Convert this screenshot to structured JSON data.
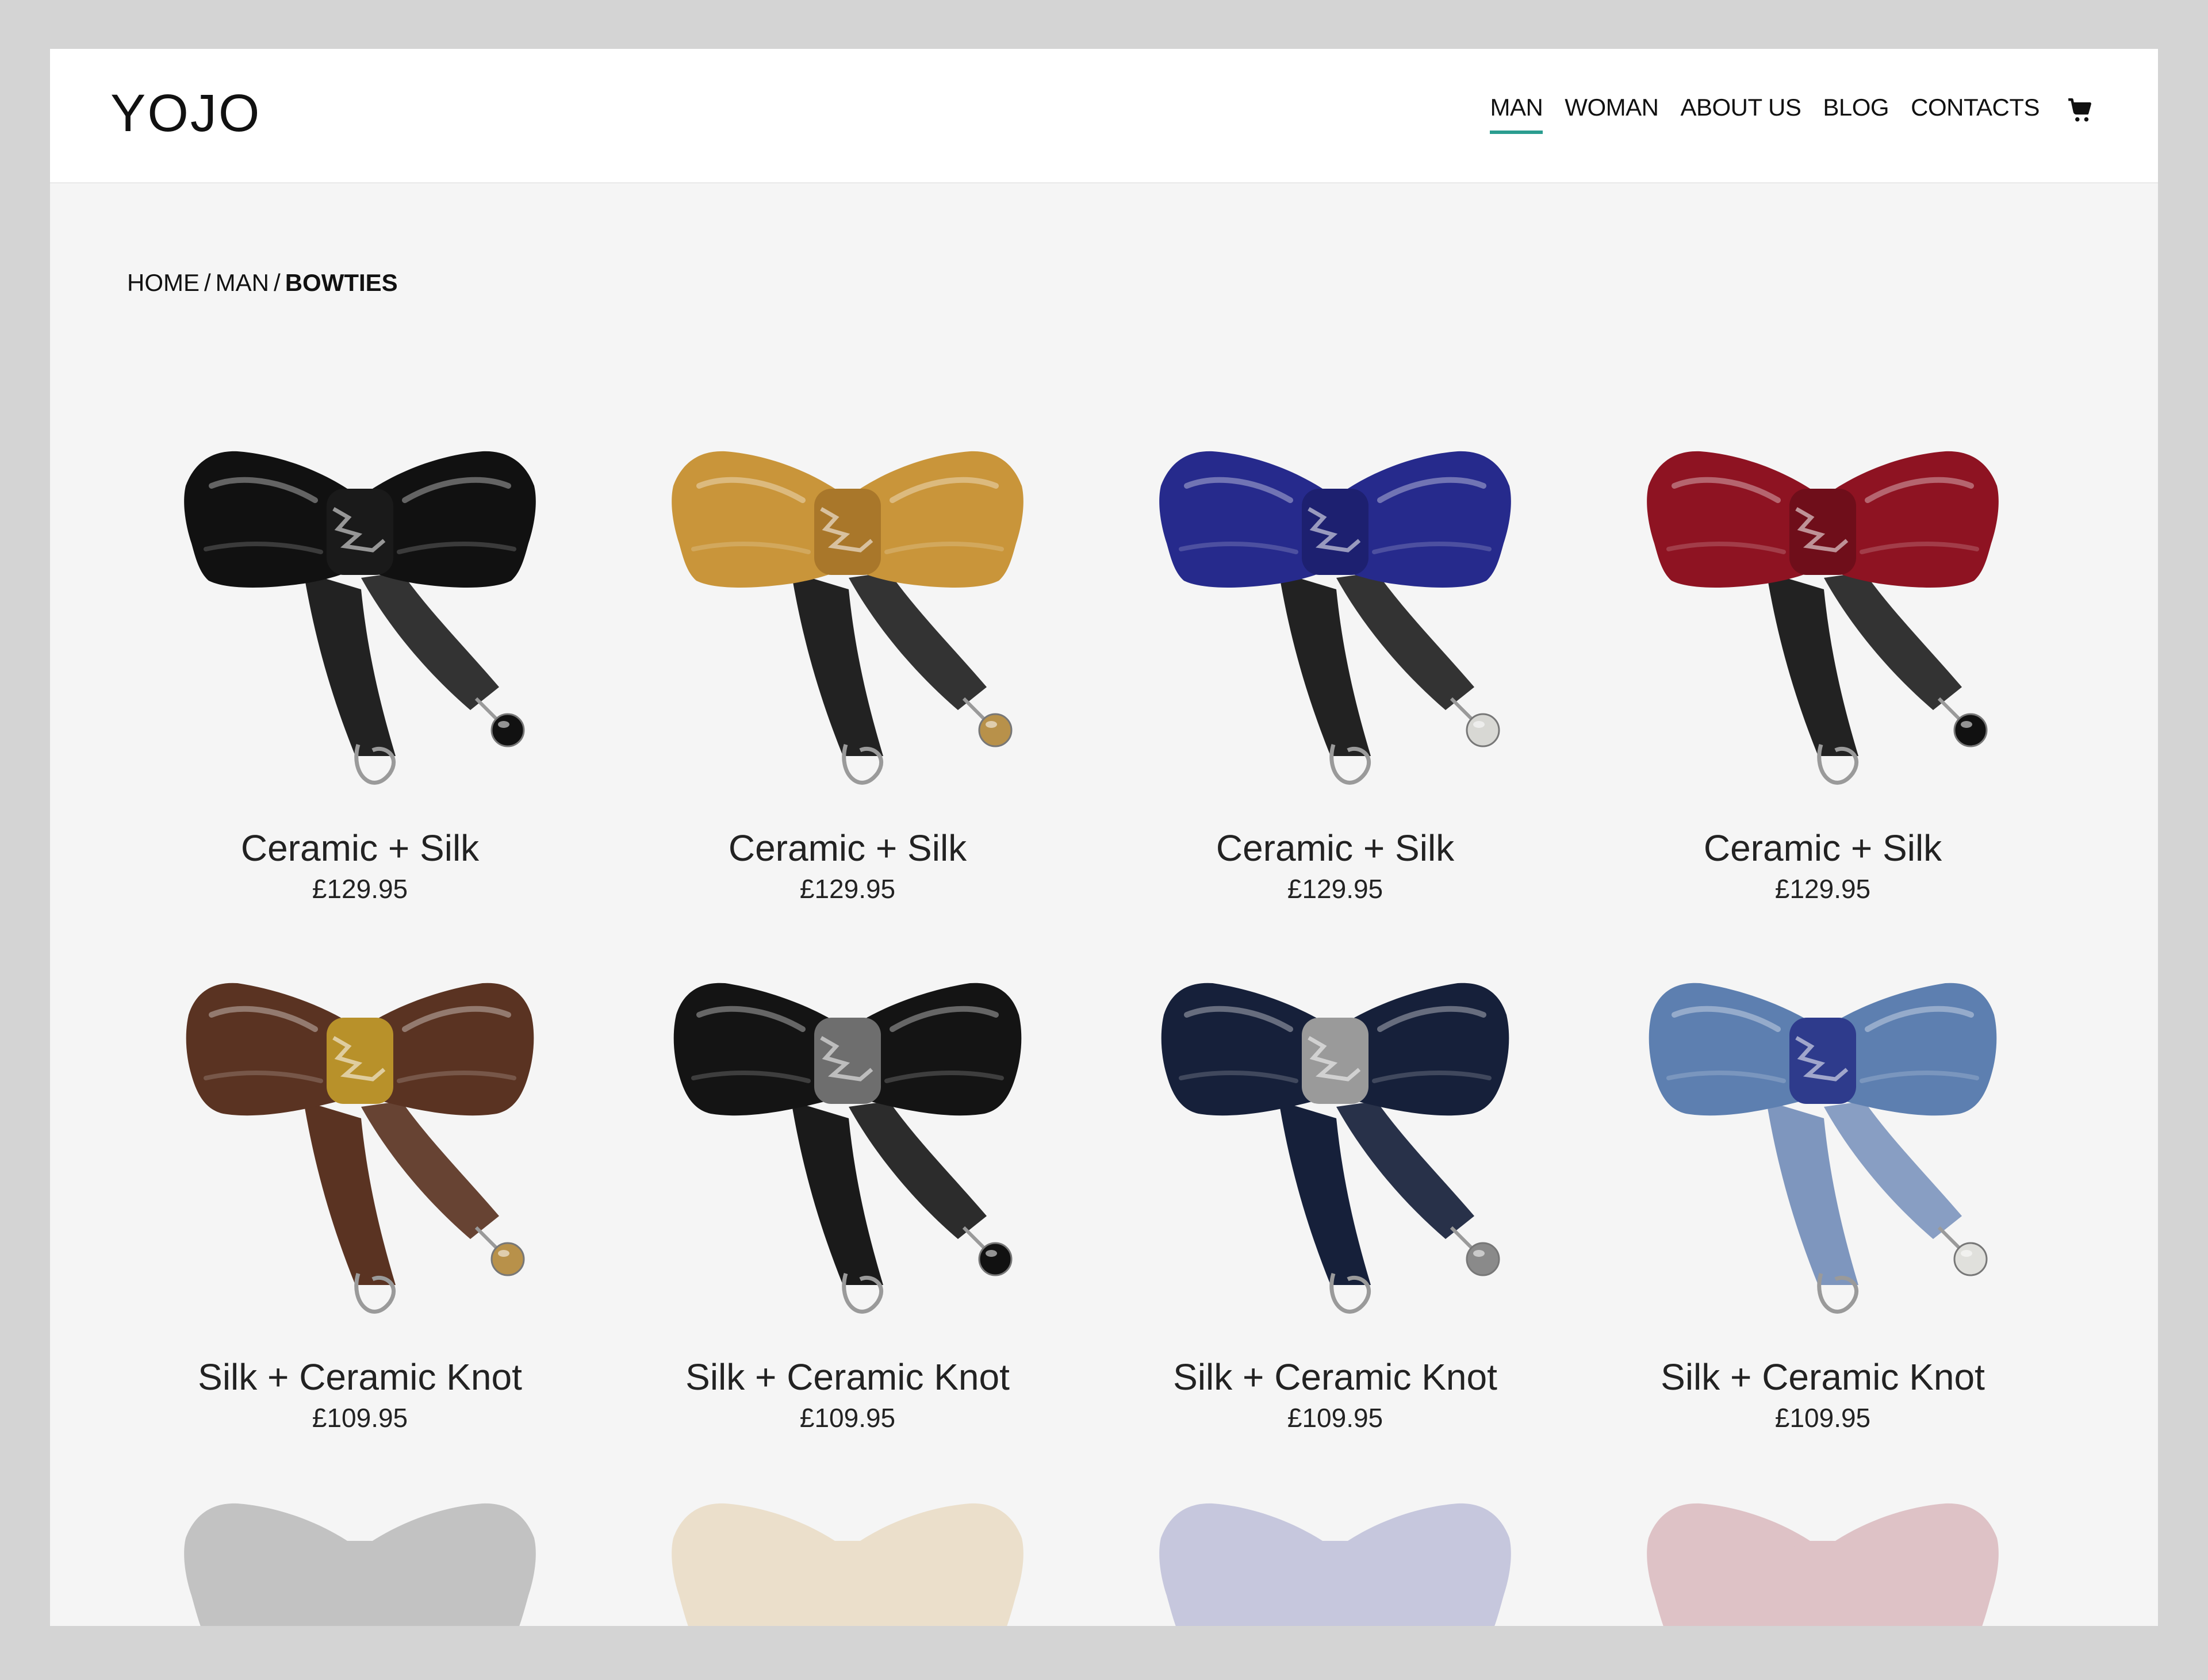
{
  "brand": {
    "logo": "YOJO"
  },
  "nav": {
    "items": [
      {
        "label": "MAN",
        "active": true
      },
      {
        "label": "WOMAN",
        "active": false
      },
      {
        "label": "ABOUT US",
        "active": false
      },
      {
        "label": "BLOG",
        "active": false
      },
      {
        "label": "CONTACTS",
        "active": false
      }
    ],
    "cart_icon": "cart-icon"
  },
  "breadcrumb": {
    "home": "HOME",
    "section": "MAN",
    "current": "BOWTIES",
    "separator": "/"
  },
  "products": [
    {
      "name": "Ceramic + Silk",
      "price": "£129.95",
      "bow_color": "#111111",
      "tail_color": "#222222",
      "knot_color": "#1a1a1a",
      "pin_color": "#111111"
    },
    {
      "name": "Ceramic + Silk",
      "price": "£129.95",
      "bow_color": "#c9953a",
      "tail_color": "#222222",
      "knot_color": "#a9772a",
      "pin_color": "#b8914a"
    },
    {
      "name": "Ceramic + Silk",
      "price": "£129.95",
      "bow_color": "#262a8c",
      "tail_color": "#222222",
      "knot_color": "#1d2070",
      "pin_color": "#d8d8d4"
    },
    {
      "name": "Ceramic + Silk",
      "price": "£129.95",
      "bow_color": "#8e1322",
      "tail_color": "#222222",
      "knot_color": "#6f0e1a",
      "pin_color": "#111111"
    },
    {
      "name": "Silk + Ceramic Knot",
      "price": "£109.95",
      "bow_color": "#5a3322",
      "tail_color": "#5a3322",
      "knot_color": "#b8912a",
      "pin_color": "#b8914a"
    },
    {
      "name": "Silk + Ceramic Knot",
      "price": "£109.95",
      "bow_color": "#141414",
      "tail_color": "#1a1a1a",
      "knot_color": "#6e6e6e",
      "pin_color": "#111111"
    },
    {
      "name": "Silk + Ceramic Knot",
      "price": "£109.95",
      "bow_color": "#16203a",
      "tail_color": "#16203a",
      "knot_color": "#9a9a9a",
      "pin_color": "#8a8a8a"
    },
    {
      "name": "Silk + Ceramic Knot",
      "price": "£109.95",
      "bow_color": "#5d7fb0",
      "tail_color": "#7e96be",
      "knot_color": "#2e3b8c",
      "pin_color": "#e0e0dc"
    }
  ],
  "ghost_row_colors": [
    "#111111",
    "#c9953a",
    "#262a8c",
    "#8e1322"
  ]
}
